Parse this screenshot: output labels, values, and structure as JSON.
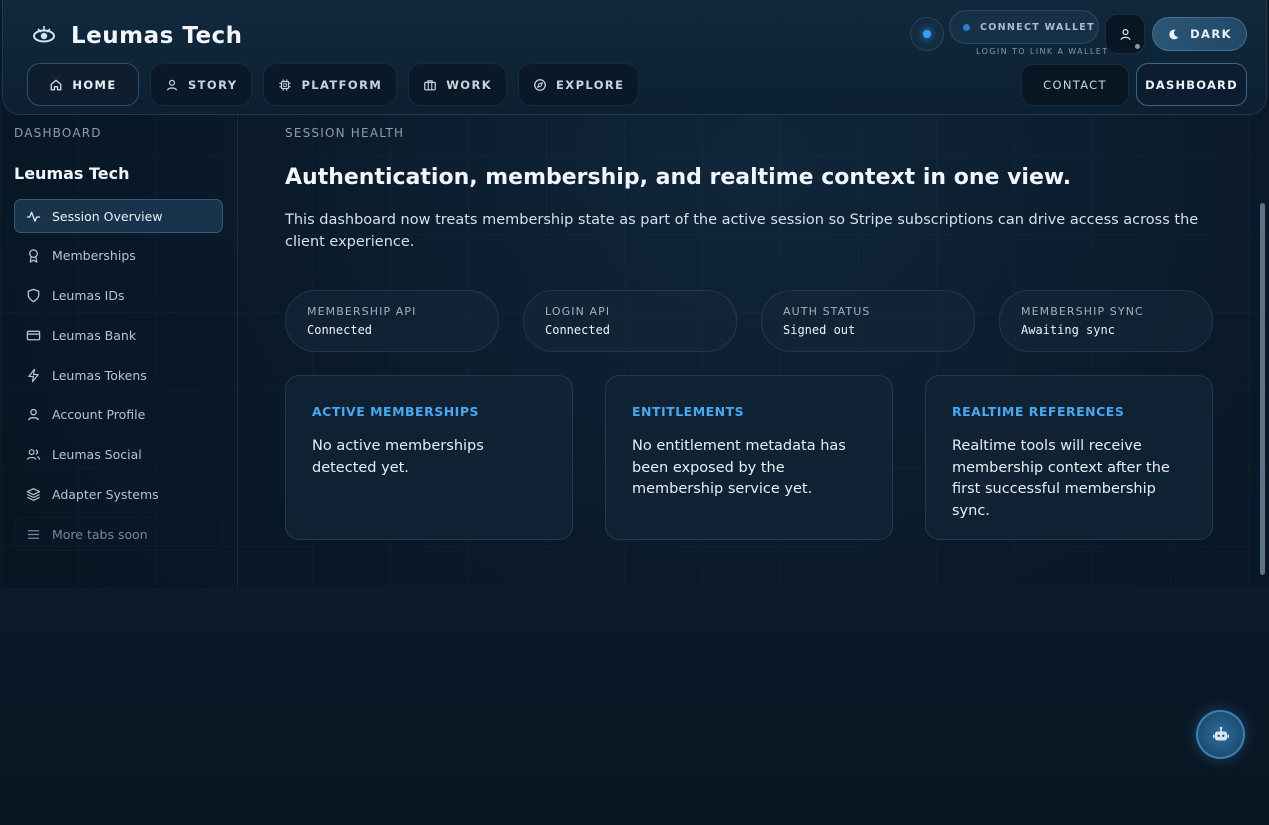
{
  "brand": {
    "name": "Leumas Tech"
  },
  "nav": [
    {
      "label": "HOME",
      "icon": "home-icon"
    },
    {
      "label": "STORY",
      "icon": "user-icon"
    },
    {
      "label": "PLATFORM",
      "icon": "chip-icon"
    },
    {
      "label": "WORK",
      "icon": "briefcase-icon"
    },
    {
      "label": "EXPLORE",
      "icon": "compass-icon"
    }
  ],
  "header": {
    "wallet_label": "CONNECT WALLET",
    "wallet_hint": "LOGIN TO LINK A WALLET",
    "theme_label": "DARK",
    "contact_label": "CONTACT",
    "dashboard_label": "DASHBOARD"
  },
  "sidebar": {
    "eyebrow": "DASHBOARD",
    "title": "Leumas Tech",
    "items": [
      {
        "label": "Session Overview",
        "icon": "activity-icon",
        "active": true
      },
      {
        "label": "Memberships",
        "icon": "award-icon"
      },
      {
        "label": "Leumas IDs",
        "icon": "shield-icon"
      },
      {
        "label": "Leumas Bank",
        "icon": "credit-card-icon"
      },
      {
        "label": "Leumas Tokens",
        "icon": "bolt-icon"
      },
      {
        "label": "Account Profile",
        "icon": "user-icon"
      },
      {
        "label": "Leumas Social",
        "icon": "users-icon"
      },
      {
        "label": "Adapter Systems",
        "icon": "layers-icon"
      },
      {
        "label": "More tabs soon",
        "icon": "menu-icon",
        "muted": true
      }
    ]
  },
  "main": {
    "eyebrow": "SESSION HEALTH",
    "headline": "Authentication, membership, and realtime context in one view.",
    "lede": "This dashboard now treats membership state as part of the active session so Stripe subscriptions can drive access across the client experience.",
    "status": [
      {
        "label": "MEMBERSHIP API",
        "value": "Connected"
      },
      {
        "label": "LOGIN API",
        "value": "Connected"
      },
      {
        "label": "AUTH STATUS",
        "value": "Signed out"
      },
      {
        "label": "MEMBERSHIP SYNC",
        "value": "Awaiting sync"
      }
    ],
    "cards": [
      {
        "title": "ACTIVE MEMBERSHIPS",
        "text": "No active memberships detected yet."
      },
      {
        "title": "ENTITLEMENTS",
        "text": "No entitlement metadata has been exposed by the membership service yet."
      },
      {
        "title": "REALTIME REFERENCES",
        "text": "Realtime tools will receive membership context after the first successful membership sync."
      }
    ]
  },
  "colors": {
    "accent": "#49a8f0",
    "status_dot": "#3aa0ff"
  }
}
